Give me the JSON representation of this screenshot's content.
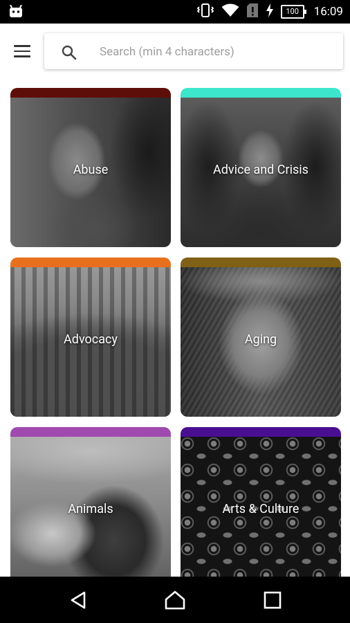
{
  "status_bar": {
    "time": "16:09",
    "battery": "100",
    "icons": [
      "android-icon",
      "vibrate-icon",
      "wifi-icon",
      "no-sim-icon",
      "charging-icon",
      "battery-icon"
    ]
  },
  "app_bar": {
    "menu_icon": "hamburger-menu-icon",
    "search": {
      "icon": "search-icon",
      "placeholder": "Search (min 4 characters)",
      "value": ""
    }
  },
  "categories": [
    {
      "label": "Abuse",
      "color": "#5e0e08"
    },
    {
      "label": "Advice and Crisis",
      "color": "#3be6cc"
    },
    {
      "label": "Advocacy",
      "color": "#e8701c"
    },
    {
      "label": "Aging",
      "color": "#806016"
    },
    {
      "label": "Animals",
      "color": "#a04ab0"
    },
    {
      "label": "Arts & Culture",
      "color": "#4a0e90"
    }
  ],
  "nav_bar": {
    "icons": [
      "back-icon",
      "home-icon",
      "recents-icon"
    ]
  }
}
